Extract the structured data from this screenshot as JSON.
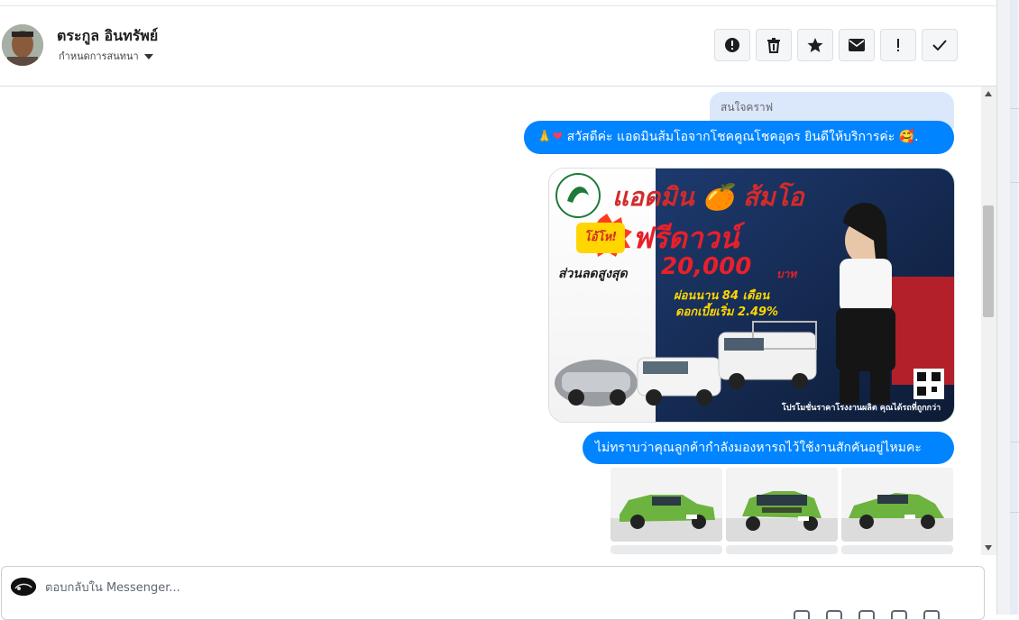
{
  "header": {
    "contact_name": "ตระกูล อินทรัพย์",
    "conversation_menu_label": "กำหนดการสนทนา",
    "toolbar": [
      {
        "name": "report-spam-button",
        "icon": "alert-circle-icon"
      },
      {
        "name": "delete-button",
        "icon": "trash-icon"
      },
      {
        "name": "star-button",
        "icon": "star-icon"
      },
      {
        "name": "mark-unread-button",
        "icon": "envelope-icon"
      },
      {
        "name": "follow-up-button",
        "icon": "exclamation-icon"
      },
      {
        "name": "mark-done-button",
        "icon": "checkmark-icon"
      }
    ]
  },
  "chat": {
    "quoted_reply": "สนใจคราฟ",
    "greeting_prefix": "🙏",
    "greeting_heart": "❤",
    "greeting_text": " สวัสดีค่ะ แอดมินส้มโอจากโชคคูณโชคอุดร ยินดีให้บริการค่ะ 🥰.",
    "promo": {
      "admin_title": "แอดมิน 🍊 ส้มโอ",
      "tag": "โอ้โห!",
      "headline": "ฟรีดาวน์",
      "discount_label": "ส่วนลดสูงสุด",
      "discount_amount": "20,000",
      "discount_unit": "บาท",
      "installment": "ผ่อนนาน 84 เดือน",
      "interest": "ดอกเบี้ยเริ่ม 2.49%",
      "slogan": "โปรโมชั่นราคาโรงงานผลิต คุณได้รถที่ถูกกว่า"
    },
    "question_text": "ไม่ทราบว่าคุณลูกค้ากำลังมองหารถไว้ใช้งานสักคันอยู่ไหมคะ"
  },
  "composer": {
    "placeholder": "ตอบกลับใน Messenger..."
  },
  "colors": {
    "bubble_blue": "#0084ff",
    "quote_bg": "#dbe7fb",
    "promo_red": "#e8202a",
    "promo_yellow": "#ffd600"
  }
}
